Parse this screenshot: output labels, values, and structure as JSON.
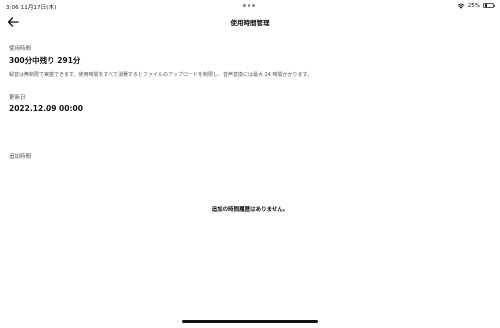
{
  "status_bar": {
    "time": "3:06",
    "date": "11月17日(木)",
    "battery_percent_label": "25%",
    "battery_level": 0.25,
    "icons": [
      "wifi-icon",
      "battery-icon"
    ]
  },
  "nav": {
    "title": "使用時間管理",
    "back_icon": "back-arrow-icon"
  },
  "usage": {
    "label": "使用時間",
    "value": "300分中残り 291分",
    "note": "録音は無制限で実施できます。使用時間をすべて消費するとファイルのアップロードを制限し、音声変換には最大 24 時間かかります。"
  },
  "renewal": {
    "label": "更新日",
    "value": "2022.12.09 00:00"
  },
  "additional": {
    "label": "追加時間",
    "empty_message": "追加の時間履歴はありません。"
  },
  "colors": {
    "background": "#ffffff",
    "text_primary": "#111111",
    "text_secondary": "#555555"
  }
}
